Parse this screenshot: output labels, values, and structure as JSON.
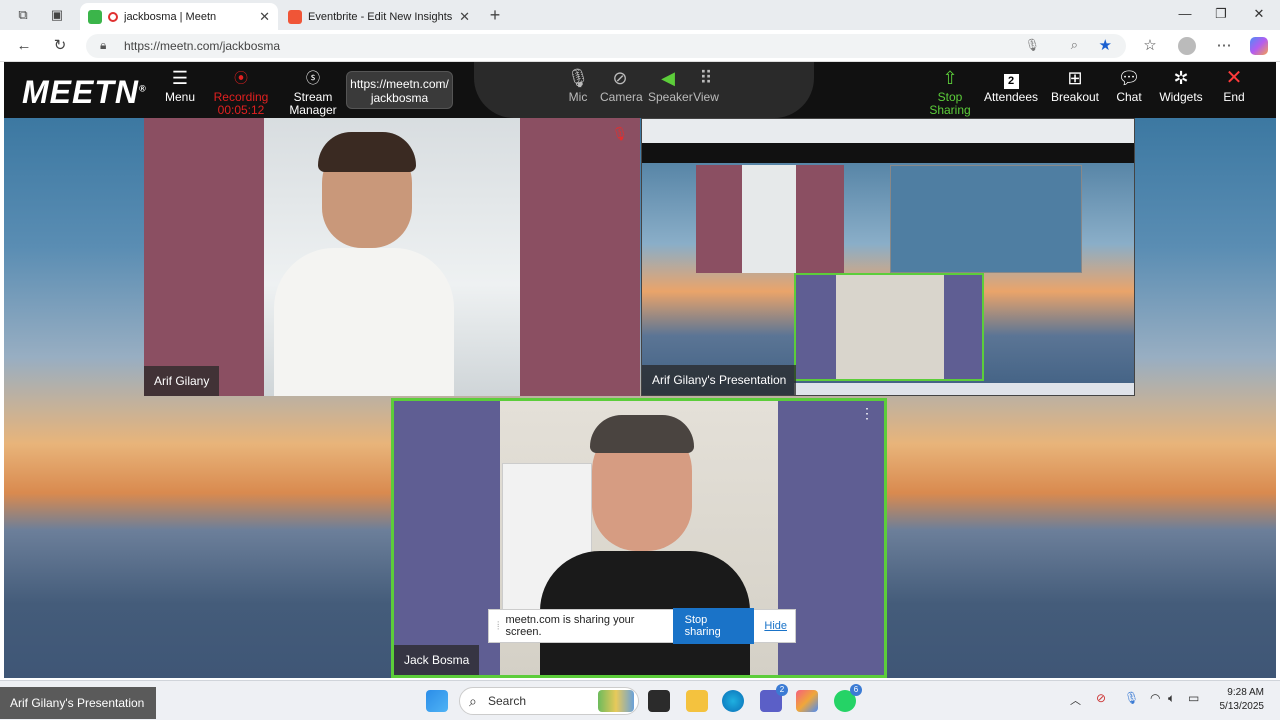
{
  "browser": {
    "tabs": [
      {
        "title": "jackbosma | Meetn",
        "active": true
      },
      {
        "title": "Eventbrite - Edit New Insights: Ca",
        "active": false
      }
    ],
    "url": "https://meetn.com/jackbosma"
  },
  "toolbar": {
    "logo": "MEETN",
    "menu": "Menu",
    "recording_label": "Recording",
    "recording_time": "00:05:12",
    "stream_manager": "Stream Manager",
    "meeting_url": "https://meetn.com/ jackbosma",
    "mic": "Mic",
    "camera": "Camera",
    "speaker": "Speaker",
    "view": "View",
    "stop_sharing": "Stop Sharing",
    "attendees_count": "2",
    "attendees": "Attendees",
    "breakout": "Breakout",
    "chat": "Chat",
    "widgets": "Widgets",
    "end": "End"
  },
  "tiles": {
    "tile1_name": "Arif Gilany",
    "tile2_name": "Arif Gilany's Presentation",
    "tile3_name": "Jack Bosma"
  },
  "share_notice": {
    "text": "meetn.com is sharing your screen.",
    "stop": "Stop sharing",
    "hide": "Hide"
  },
  "taskbar": {
    "search": "Search",
    "time": "9:28 AM",
    "date": "5/13/2025",
    "tooltip": "Arif Gilany's Presentation",
    "badge_teams": "2",
    "badge_whatsapp": "6"
  },
  "colors": {
    "accent": "#1a73c8",
    "tile_maroon": "#8b4f62",
    "tile_purple": "#5f5e93",
    "speaker_green": "#5ccd3a",
    "recording_red": "#e02020"
  }
}
